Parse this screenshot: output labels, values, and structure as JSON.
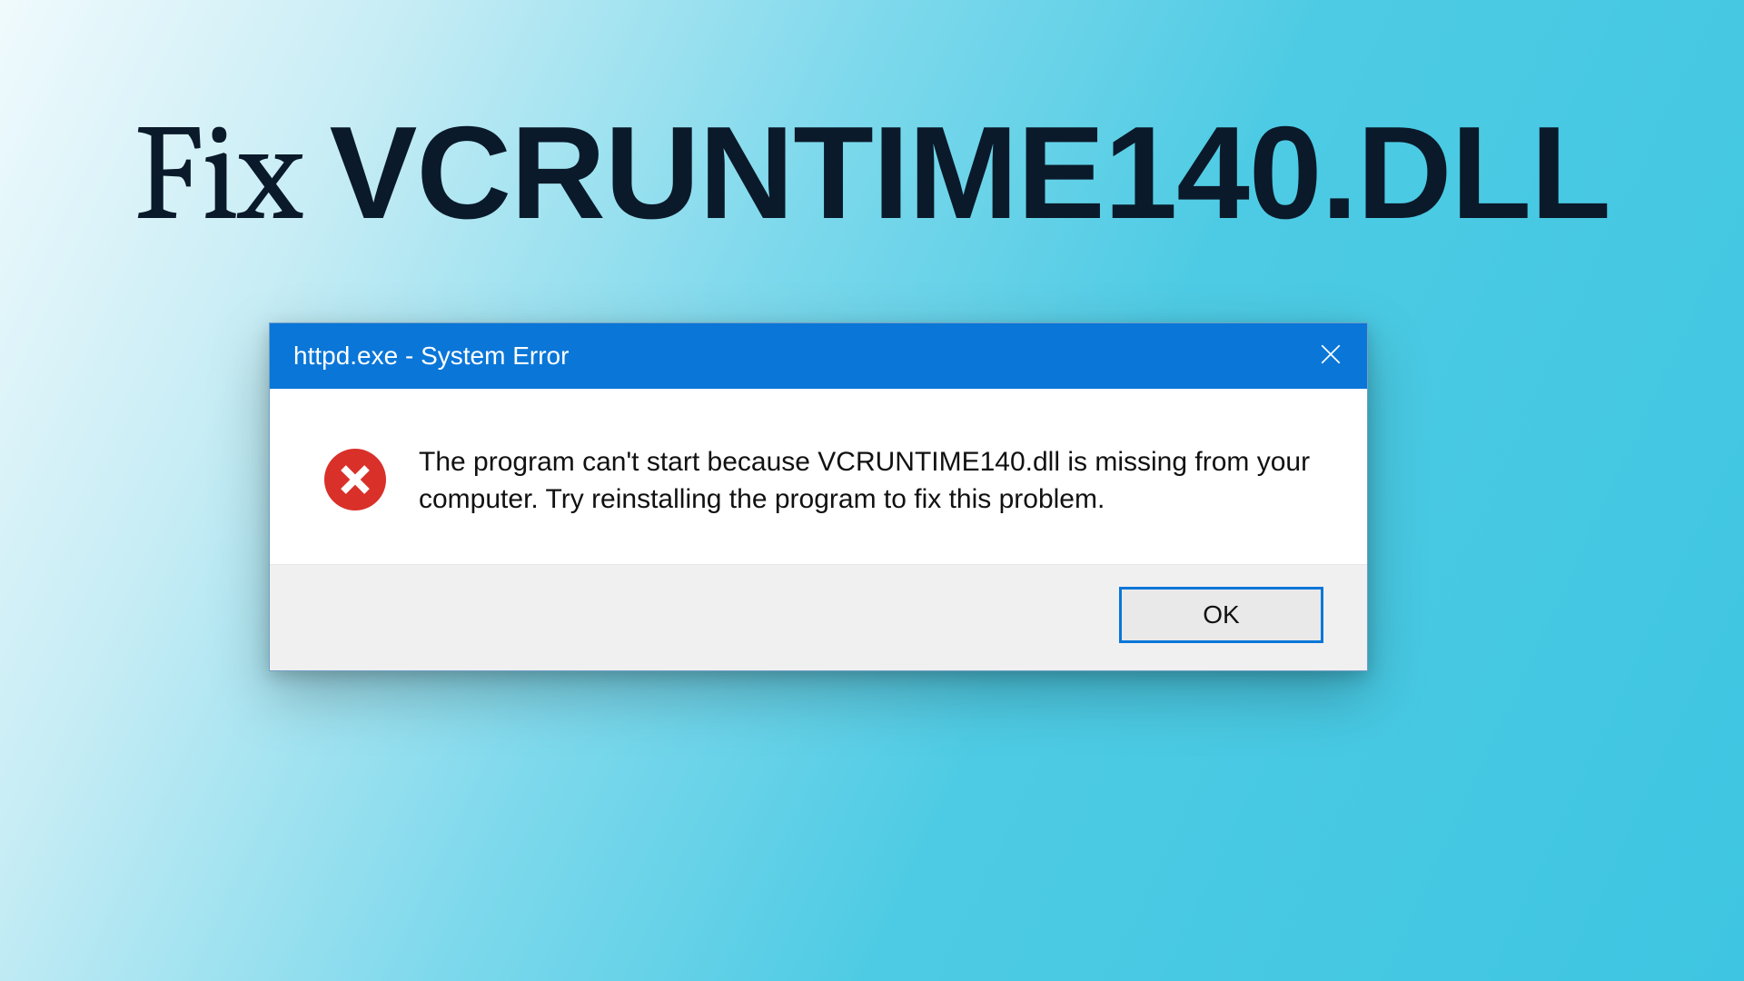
{
  "heading": {
    "prefix": "Fix ",
    "bold": "VCRUNTIME140.DLL"
  },
  "dialog": {
    "title": "httpd.exe - System Error",
    "message": "The program can't start because VCRUNTIME140.dll is missing from your computer. Try reinstalling the program to fix this problem.",
    "ok_label": "OK"
  }
}
